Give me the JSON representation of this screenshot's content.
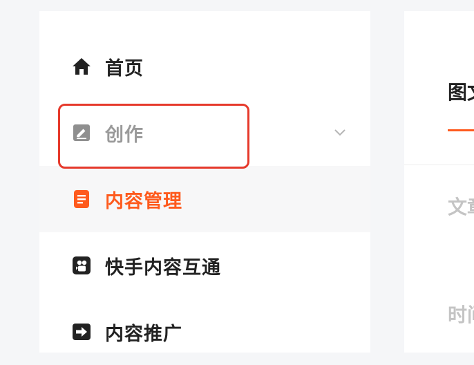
{
  "sidebar": {
    "items": [
      {
        "label": "首页",
        "icon": "home-icon"
      },
      {
        "label": "创作",
        "icon": "edit-icon",
        "expandable": true
      },
      {
        "label": "内容管理",
        "icon": "document-icon",
        "active": true
      },
      {
        "label": "快手内容互通",
        "icon": "kuaishou-icon"
      },
      {
        "label": "内容推广",
        "icon": "promote-arrow-icon"
      }
    ]
  },
  "content": {
    "tab_label": "图文",
    "field1_label": "文章",
    "field2_label": "时间"
  },
  "colors": {
    "accent": "#fe5a1d",
    "highlight_border": "#e6392b",
    "text_primary": "#222222",
    "text_muted": "#9a9a9a"
  }
}
